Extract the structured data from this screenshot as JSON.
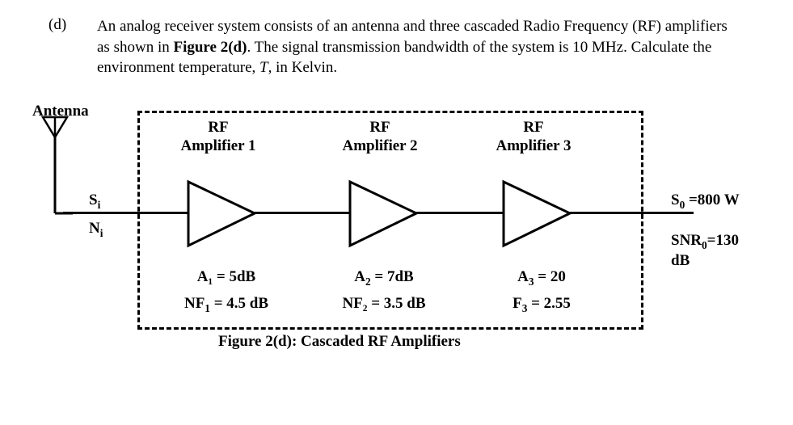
{
  "question": {
    "label": "(d)",
    "text_before_bold": "An analog receiver system consists of an antenna and three cascaded Radio Frequency (RF) amplifiers as shown in ",
    "bold_ref": "Figure 2(d)",
    "text_after_bold": ". The signal transmission bandwidth of the system is 10 MHz. Calculate the environment temperature, ",
    "italic_T": "T",
    "text_end": ", in Kelvin."
  },
  "antenna_label": "Antenna",
  "input_labels": {
    "Si": "S",
    "Si_sub": "i",
    "Ni": "N",
    "Ni_sub": "i"
  },
  "amps": [
    {
      "title_l1": "RF",
      "title_l2": "Amplifier 1"
    },
    {
      "title_l1": "RF",
      "title_l2": "Amplifier 2"
    },
    {
      "title_l1": "RF",
      "title_l2": "Amplifier 3"
    }
  ],
  "params": {
    "a1": "A₁ = 5dB",
    "nf1_pre": "NF",
    "nf1_sub": "1",
    "nf1_post": " = 4.5 dB",
    "a2_pre": "A",
    "a2_sub": "2",
    "a2_post": " = 7dB",
    "nf2": "NF₂ = 3.5 dB",
    "a3_pre": "A",
    "a3_sub": "3",
    "a3_post": " = 20",
    "f3_pre": "F",
    "f3_sub": "3",
    "f3_post": " = 2.55"
  },
  "output": {
    "so_pre": "S",
    "so_sub": "0",
    "so_post": " =800 W",
    "snr_pre": "SNR",
    "snr_sub": "0",
    "snr_post": "=130 dB"
  },
  "caption": "Figure 2(d): Cascaded RF Amplifiers",
  "chart_data": {
    "type": "diagram",
    "description": "Block diagram of cascaded RF amplifier chain",
    "blocks": [
      {
        "name": "Antenna",
        "outputs": [
          "Si",
          "Ni"
        ]
      },
      {
        "name": "RF Amplifier 1",
        "gain_dB": 5,
        "noise_figure_dB": 4.5
      },
      {
        "name": "RF Amplifier 2",
        "gain_dB": 7,
        "noise_figure_dB": 3.5
      },
      {
        "name": "RF Amplifier 3",
        "gain_linear": 20,
        "noise_factor_linear": 2.55
      }
    ],
    "output": {
      "So_W": 800,
      "SNRo_dB": 130
    },
    "system_bandwidth_MHz": 10
  }
}
